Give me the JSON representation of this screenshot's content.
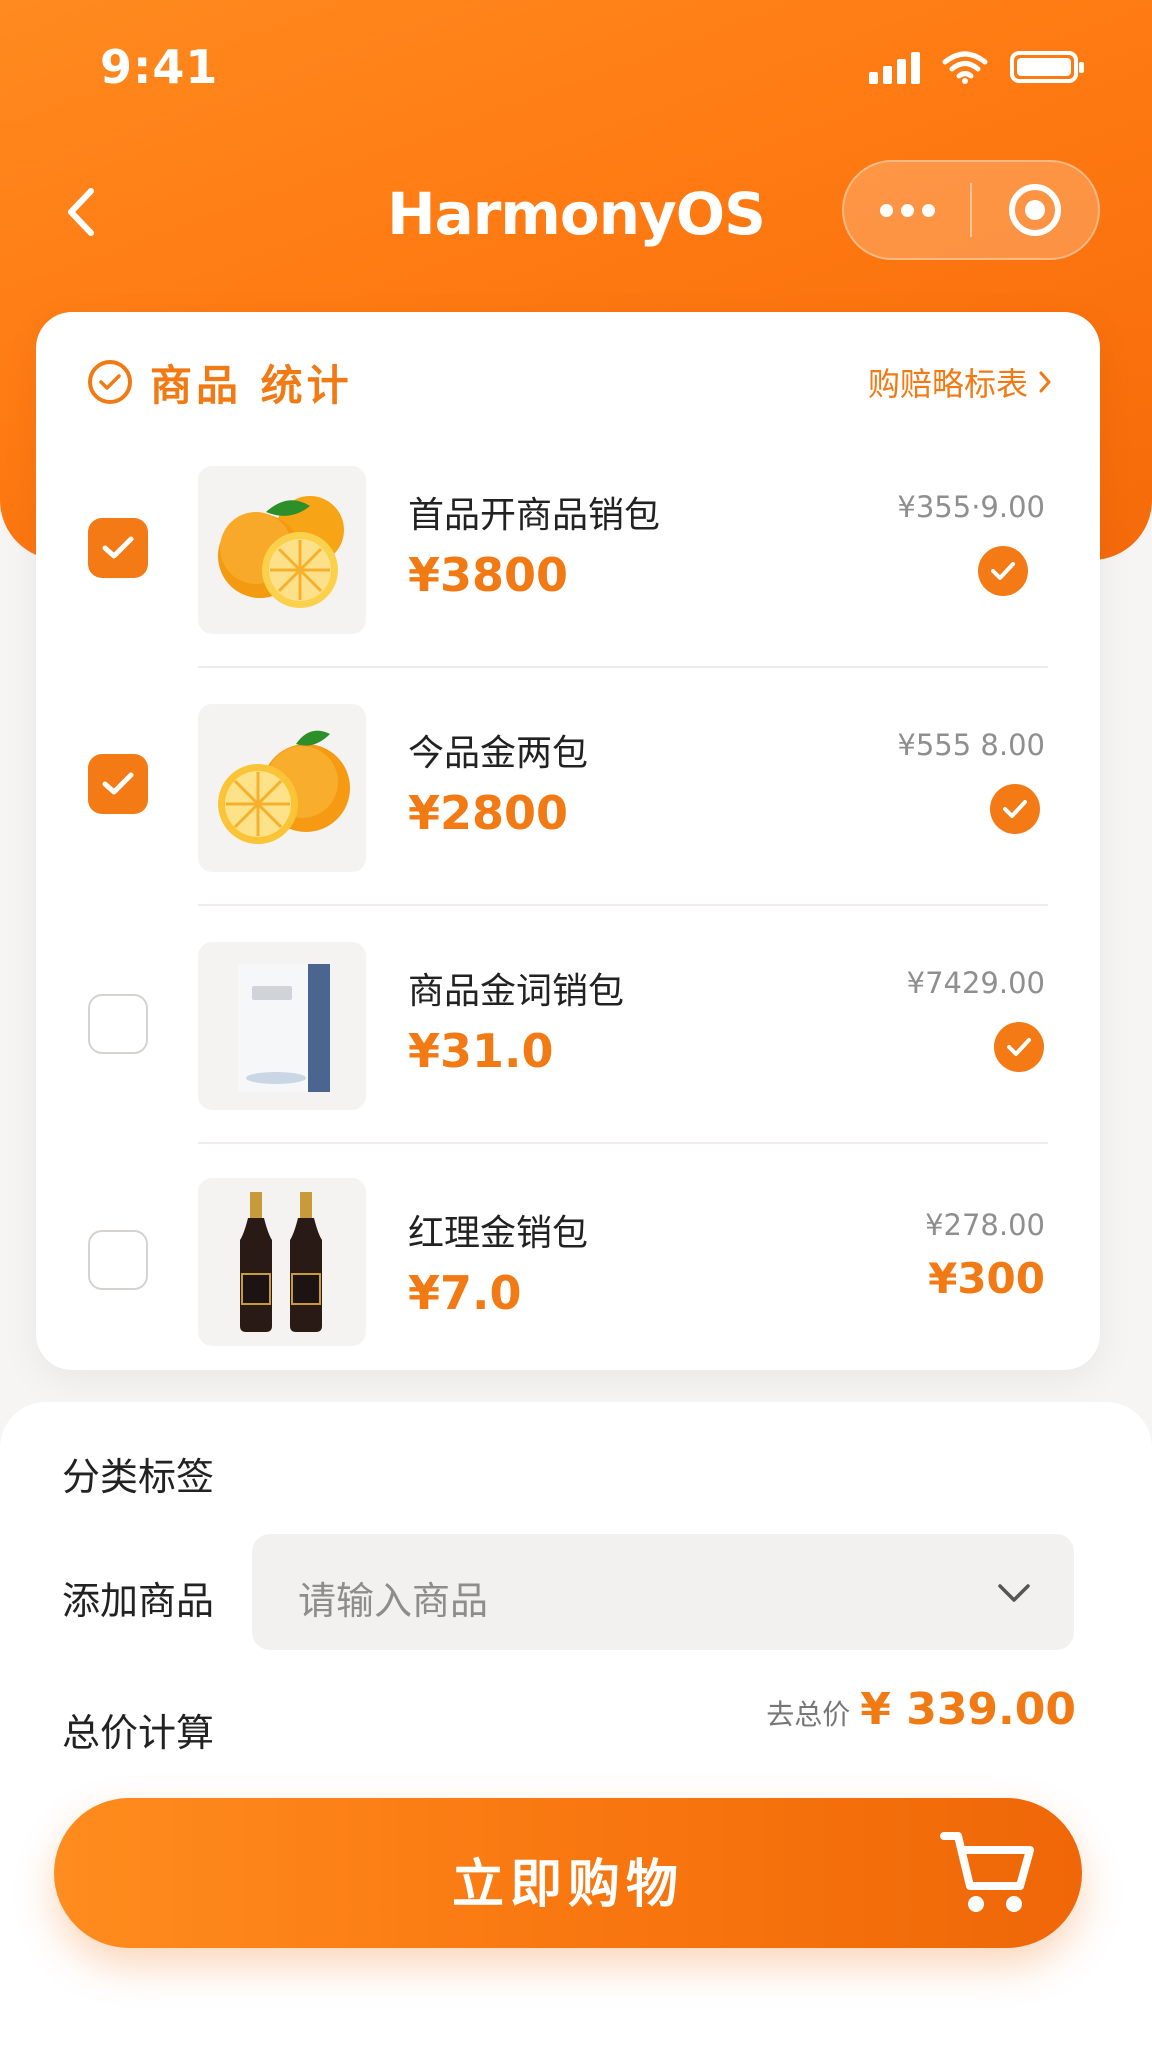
{
  "status_bar": {
    "time": "9:41"
  },
  "nav": {
    "title": "HarmonyOS"
  },
  "card": {
    "title": "商品 统计",
    "link_label": "购赔略标表"
  },
  "products": [
    {
      "name": "首品开商品销包",
      "price": "¥3800",
      "original_price": "¥355·9.00",
      "side": "tick",
      "checked": true,
      "image": "oranges-icon"
    },
    {
      "name": "今品金两包",
      "price": "¥2800",
      "original_price": "¥555 8.00",
      "side": "tick",
      "checked": true,
      "image": "orange-icon"
    },
    {
      "name": "商品金词销包",
      "price": "¥31.0",
      "original_price": "¥7429.00",
      "side": "tick",
      "checked": false,
      "image": "bag-icon"
    },
    {
      "name": "红理金销包",
      "price": "¥7.0",
      "original_price": "¥278.00",
      "side_price": "¥300",
      "side": "price",
      "checked": false,
      "image": "bottles-icon"
    }
  ],
  "form": {
    "category_label": "分类标签",
    "add_label": "添加商品",
    "add_placeholder": "请输入商品",
    "total_label": "总价计算",
    "total_prefix": "去总价",
    "total_value": "¥ 339.00"
  },
  "buy_button": {
    "label": "立即购物"
  },
  "colors": {
    "accent": "#f47a16",
    "accent_dark": "#ef6708",
    "hero": "#ff7a12"
  }
}
